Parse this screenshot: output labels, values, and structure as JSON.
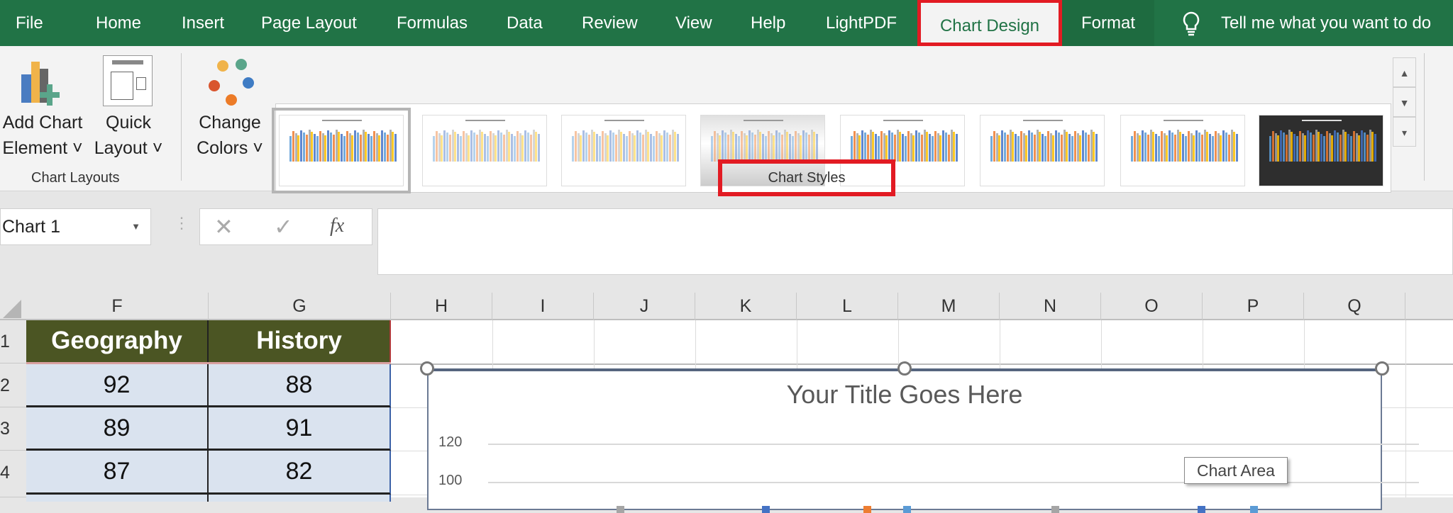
{
  "ribbon_tabs": [
    {
      "label": "File"
    },
    {
      "label": "Home"
    },
    {
      "label": "Insert"
    },
    {
      "label": "Page Layout"
    },
    {
      "label": "Formulas"
    },
    {
      "label": "Data"
    },
    {
      "label": "Review"
    },
    {
      "label": "View"
    },
    {
      "label": "Help"
    },
    {
      "label": "LightPDF"
    },
    {
      "label": "Chart Design"
    },
    {
      "label": "Format"
    }
  ],
  "active_tab": "Chart Design",
  "tell_me": "Tell me what you want to do",
  "ribbon": {
    "add_chart_element": [
      "Add Chart",
      "Element ˅"
    ],
    "quick_layout": [
      "Quick",
      "Layout ˅"
    ],
    "change_colors": [
      "Change",
      "Colors ˅"
    ],
    "chart_layouts_label": "Chart Layouts",
    "chart_styles_label": "Chart Styles",
    "chart_styles_count": 8,
    "selected_style": 1
  },
  "formula_bar": {
    "name_box": "Chart 1",
    "cancel_icon": "✕",
    "enter_icon": "✓",
    "fx_icon": "fx",
    "value": ""
  },
  "columns": [
    "F",
    "G",
    "H",
    "I",
    "J",
    "K",
    "L",
    "M",
    "N",
    "O",
    "P",
    "Q"
  ],
  "rows": [
    "1",
    "2",
    "3",
    "4"
  ],
  "table": {
    "headers": [
      "Geography",
      "History"
    ],
    "rows": [
      [
        "92",
        "88"
      ],
      [
        "89",
        "91"
      ],
      [
        "87",
        "82"
      ]
    ]
  },
  "chart": {
    "title": "Your Title Goes Here",
    "y_ticks": [
      "120",
      "100"
    ],
    "tooltip": "Chart Area"
  },
  "colors": {
    "ribbon_green": "#217346",
    "highlight_red": "#e21b23",
    "header_fill": "#4b5523",
    "data_fill": "#dae3ef"
  }
}
